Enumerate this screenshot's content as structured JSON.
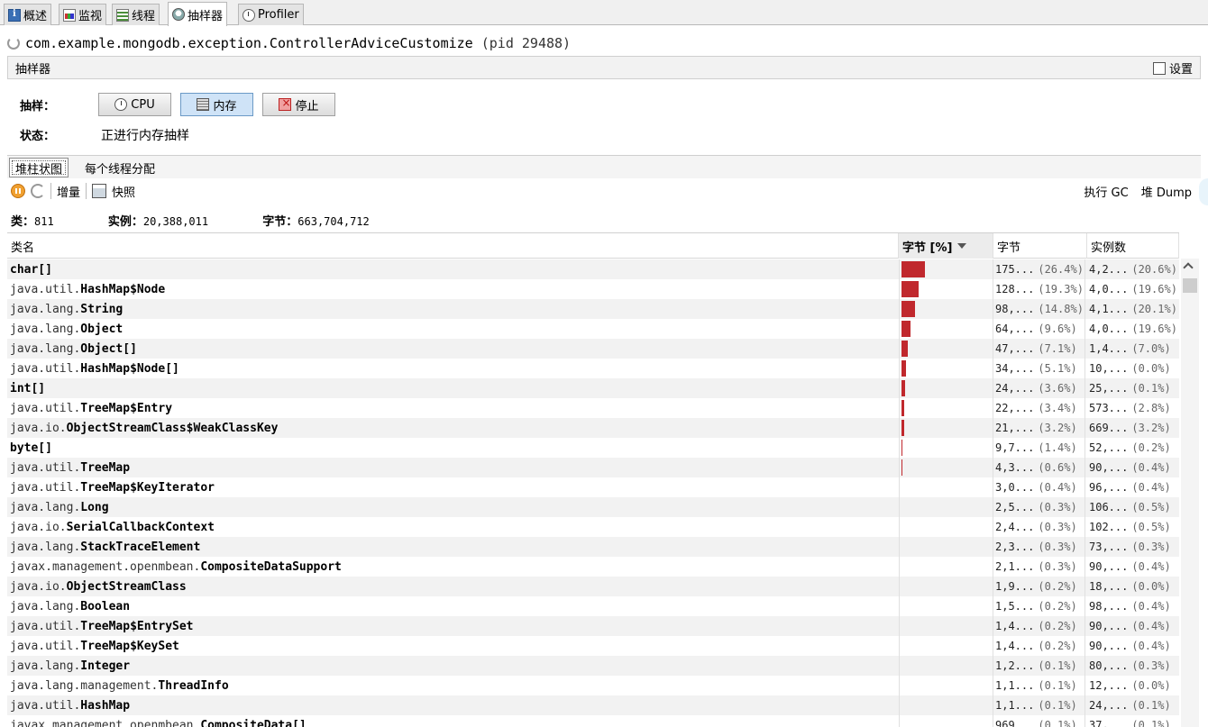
{
  "tabs": [
    {
      "label": "概述",
      "icon": "overview-icon"
    },
    {
      "label": "监视",
      "icon": "monitor-icon"
    },
    {
      "label": "线程",
      "icon": "threads-icon"
    },
    {
      "label": "抽样器",
      "icon": "sampler-icon",
      "active": true
    },
    {
      "label": "Profiler",
      "icon": "profiler-icon"
    }
  ],
  "app": {
    "process_name": "com.example.mongodb.exception.ControllerAdviceCustomize",
    "pid_text": "(pid 29488)"
  },
  "panel": {
    "title": "抽样器",
    "settings_label": "设置"
  },
  "controls": {
    "sample_label": "抽样：",
    "cpu_button": "CPU",
    "memory_button": "内存",
    "stop_button": "停止",
    "status_label": "状态：",
    "status_value": "正进行内存抽样"
  },
  "subtabs": {
    "histogram": "堆柱状图",
    "per_thread": "每个线程分配"
  },
  "toolbar": {
    "delta": "增量",
    "snapshot": "快照",
    "run_gc": "执行 GC",
    "heap_dump": "堆 Dump"
  },
  "summary": {
    "classes_label": "类：",
    "classes_value": "811",
    "instances_label": "实例：",
    "instances_value": "20,388,011",
    "bytes_label": "字节：",
    "bytes_value": "663,704,712"
  },
  "table": {
    "columns": {
      "name": "类名",
      "bytes_pct": "字节 [%]",
      "bytes": "字节",
      "instances": "实例数"
    },
    "rows": [
      {
        "pkg": "",
        "cls": "char[]",
        "bytes": "175...",
        "bytes_pct": "(26.4%)",
        "inst": "4,2...",
        "inst_pct": "(20.6%)",
        "fraction": 0.264
      },
      {
        "pkg": "java.util.",
        "cls": "HashMap$Node",
        "bytes": "128...",
        "bytes_pct": "(19.3%)",
        "inst": "4,0...",
        "inst_pct": "(19.6%)",
        "fraction": 0.193
      },
      {
        "pkg": "java.lang.",
        "cls": "String",
        "bytes": "98,...",
        "bytes_pct": "(14.8%)",
        "inst": "4,1...",
        "inst_pct": "(20.1%)",
        "fraction": 0.148
      },
      {
        "pkg": "java.lang.",
        "cls": "Object",
        "bytes": "64,...",
        "bytes_pct": "(9.6%)",
        "inst": "4,0...",
        "inst_pct": "(19.6%)",
        "fraction": 0.096
      },
      {
        "pkg": "java.lang.",
        "cls": "Object[]",
        "bytes": "47,...",
        "bytes_pct": "(7.1%)",
        "inst": "1,4...",
        "inst_pct": "(7.0%)",
        "fraction": 0.071
      },
      {
        "pkg": "java.util.",
        "cls": "HashMap$Node[]",
        "bytes": "34,...",
        "bytes_pct": "(5.1%)",
        "inst": "10,...",
        "inst_pct": "(0.0%)",
        "fraction": 0.051
      },
      {
        "pkg": "",
        "cls": "int[]",
        "bytes": "24,...",
        "bytes_pct": "(3.6%)",
        "inst": "25,...",
        "inst_pct": "(0.1%)",
        "fraction": 0.036
      },
      {
        "pkg": "java.util.",
        "cls": "TreeMap$Entry",
        "bytes": "22,...",
        "bytes_pct": "(3.4%)",
        "inst": "573...",
        "inst_pct": "(2.8%)",
        "fraction": 0.034
      },
      {
        "pkg": "java.io.",
        "cls": "ObjectStreamClass$WeakClassKey",
        "bytes": "21,...",
        "bytes_pct": "(3.2%)",
        "inst": "669...",
        "inst_pct": "(3.2%)",
        "fraction": 0.032
      },
      {
        "pkg": "",
        "cls": "byte[]",
        "bytes": "9,7...",
        "bytes_pct": "(1.4%)",
        "inst": "52,...",
        "inst_pct": "(0.2%)",
        "fraction": 0.014
      },
      {
        "pkg": "java.util.",
        "cls": "TreeMap",
        "bytes": "4,3...",
        "bytes_pct": "(0.6%)",
        "inst": "90,...",
        "inst_pct": "(0.4%)",
        "fraction": 0.006
      },
      {
        "pkg": "java.util.",
        "cls": "TreeMap$KeyIterator",
        "bytes": "3,0...",
        "bytes_pct": "(0.4%)",
        "inst": "96,...",
        "inst_pct": "(0.4%)",
        "fraction": 0.004
      },
      {
        "pkg": "java.lang.",
        "cls": "Long",
        "bytes": "2,5...",
        "bytes_pct": "(0.3%)",
        "inst": "106...",
        "inst_pct": "(0.5%)",
        "fraction": 0.003
      },
      {
        "pkg": "java.io.",
        "cls": "SerialCallbackContext",
        "bytes": "2,4...",
        "bytes_pct": "(0.3%)",
        "inst": "102...",
        "inst_pct": "(0.5%)",
        "fraction": 0.003
      },
      {
        "pkg": "java.lang.",
        "cls": "StackTraceElement",
        "bytes": "2,3...",
        "bytes_pct": "(0.3%)",
        "inst": "73,...",
        "inst_pct": "(0.3%)",
        "fraction": 0.003
      },
      {
        "pkg": "javax.management.openmbean.",
        "cls": "CompositeDataSupport",
        "bytes": "2,1...",
        "bytes_pct": "(0.3%)",
        "inst": "90,...",
        "inst_pct": "(0.4%)",
        "fraction": 0.003
      },
      {
        "pkg": "java.io.",
        "cls": "ObjectStreamClass",
        "bytes": "1,9...",
        "bytes_pct": "(0.2%)",
        "inst": "18,...",
        "inst_pct": "(0.0%)",
        "fraction": 0.002
      },
      {
        "pkg": "java.lang.",
        "cls": "Boolean",
        "bytes": "1,5...",
        "bytes_pct": "(0.2%)",
        "inst": "98,...",
        "inst_pct": "(0.4%)",
        "fraction": 0.002
      },
      {
        "pkg": "java.util.",
        "cls": "TreeMap$EntrySet",
        "bytes": "1,4...",
        "bytes_pct": "(0.2%)",
        "inst": "90,...",
        "inst_pct": "(0.4%)",
        "fraction": 0.002
      },
      {
        "pkg": "java.util.",
        "cls": "TreeMap$KeySet",
        "bytes": "1,4...",
        "bytes_pct": "(0.2%)",
        "inst": "90,...",
        "inst_pct": "(0.4%)",
        "fraction": 0.002
      },
      {
        "pkg": "java.lang.",
        "cls": "Integer",
        "bytes": "1,2...",
        "bytes_pct": "(0.1%)",
        "inst": "80,...",
        "inst_pct": "(0.3%)",
        "fraction": 0.001
      },
      {
        "pkg": "java.lang.management.",
        "cls": "ThreadInfo",
        "bytes": "1,1...",
        "bytes_pct": "(0.1%)",
        "inst": "12,...",
        "inst_pct": "(0.0%)",
        "fraction": 0.001
      },
      {
        "pkg": "java.util.",
        "cls": "HashMap",
        "bytes": "1,1...",
        "bytes_pct": "(0.1%)",
        "inst": "24,...",
        "inst_pct": "(0.1%)",
        "fraction": 0.001
      },
      {
        "pkg": "javax.management.openmbean.",
        "cls": "CompositeData[]",
        "bytes": "969...",
        "bytes_pct": "(0.1%)",
        "inst": "37,...",
        "inst_pct": "(0.1%)",
        "fraction": 0.001
      }
    ]
  },
  "colors": {
    "bar": "#c0282d"
  }
}
